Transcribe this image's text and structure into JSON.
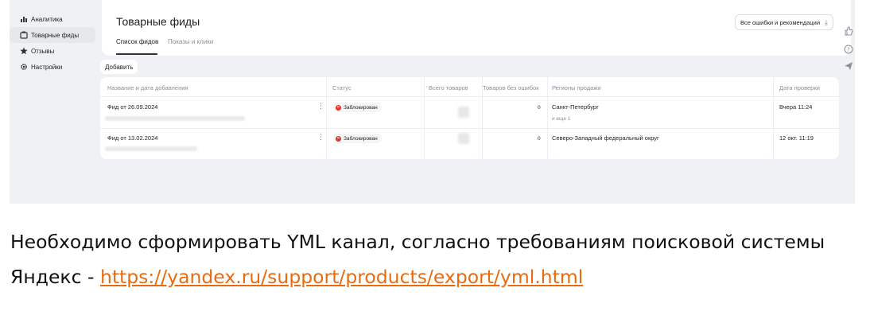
{
  "sidebar": {
    "items": [
      {
        "label": "Аналитика",
        "icon": "analytics-icon"
      },
      {
        "label": "Товарные фиды",
        "icon": "feed-icon",
        "active": true
      },
      {
        "label": "Отзывы",
        "icon": "star-icon"
      },
      {
        "label": "Настройки",
        "icon": "gear-icon"
      }
    ]
  },
  "header": {
    "title": "Товарные фиды",
    "tabs": [
      {
        "label": "Список фидов",
        "active": true
      },
      {
        "label": "Показы и клики",
        "active": false
      }
    ],
    "errors_button": "Все ошибки и рекомендации"
  },
  "add_button": "Добавить",
  "table": {
    "columns": [
      "Название и дата добавления",
      "Статус",
      "Всего товаров",
      "Товаров без ошибок",
      "Регионы продажи",
      "Дата проверки"
    ],
    "rows": [
      {
        "name": "Фид от 26.09.2024",
        "status": "Заблокирован",
        "without_errors": "0",
        "region": "Санкт-Петербург",
        "region_more": "и еще 1",
        "checked": "Вчера 11:24"
      },
      {
        "name": "Фид от 13.02.2024",
        "status": "Заблокирован",
        "without_errors": "0",
        "region": "Северо-Западный федеральный округ",
        "region_more": "",
        "checked": "12 окт. 11:19"
      }
    ]
  },
  "caption": {
    "text": "Необходимо сформировать YML канал, согласно требованиям поисковой системы Яндекс - ",
    "link": "https://yandex.ru/support/products/export/yml.html"
  },
  "colors": {
    "link": "#e86b11",
    "status_error": "#e0352b",
    "background": "#f0f1f4"
  }
}
